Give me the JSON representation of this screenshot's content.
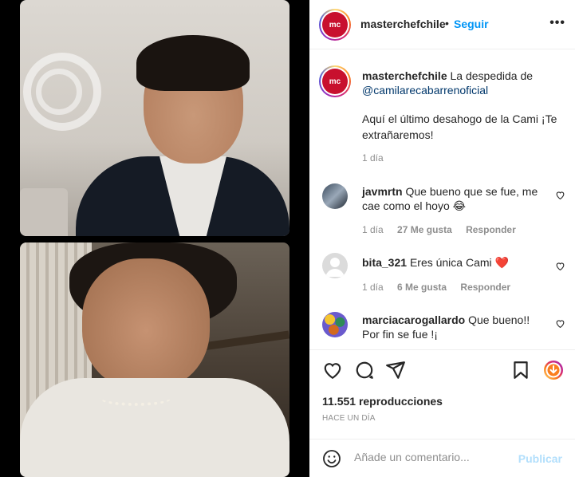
{
  "header": {
    "username": "masterchefchile",
    "separator": "•",
    "follow_label": "Seguir",
    "more_icon": "more-horizontal-icon",
    "more_glyph": "•••"
  },
  "caption": {
    "username": "masterchefchile",
    "text": "La despedida de",
    "mention": "@camilarecabarrenoficial",
    "body": "Aquí el último desahogo de la Cami ¡Te extrañaremos!",
    "time": "1 día"
  },
  "comments": [
    {
      "username": "javmrtn",
      "text": "Que bueno que se fue, me cae como el hoyo",
      "emoji": "😂",
      "time": "1 día",
      "likes": "27 Me gusta",
      "reply": "Responder"
    },
    {
      "username": "bita_321",
      "text": "Eres única Cami",
      "emoji": "❤️",
      "time": "1 día",
      "likes": "6 Me gusta",
      "reply": "Responder"
    },
    {
      "username": "marciacarogallardo",
      "text": "Que bueno!! Por fin se fue !¡"
    }
  ],
  "actions": {
    "views": "11.551 reproducciones",
    "time_ago": "HACE UN DÍA"
  },
  "add_comment": {
    "placeholder": "Añade un comentario...",
    "publish_label": "Publicar"
  },
  "colors": {
    "link_blue": "#0095f6",
    "mention_blue": "#00376b",
    "muted": "#8e8e8e",
    "publish_disabled": "#b2dffc",
    "brand_red": "#c8102e"
  }
}
